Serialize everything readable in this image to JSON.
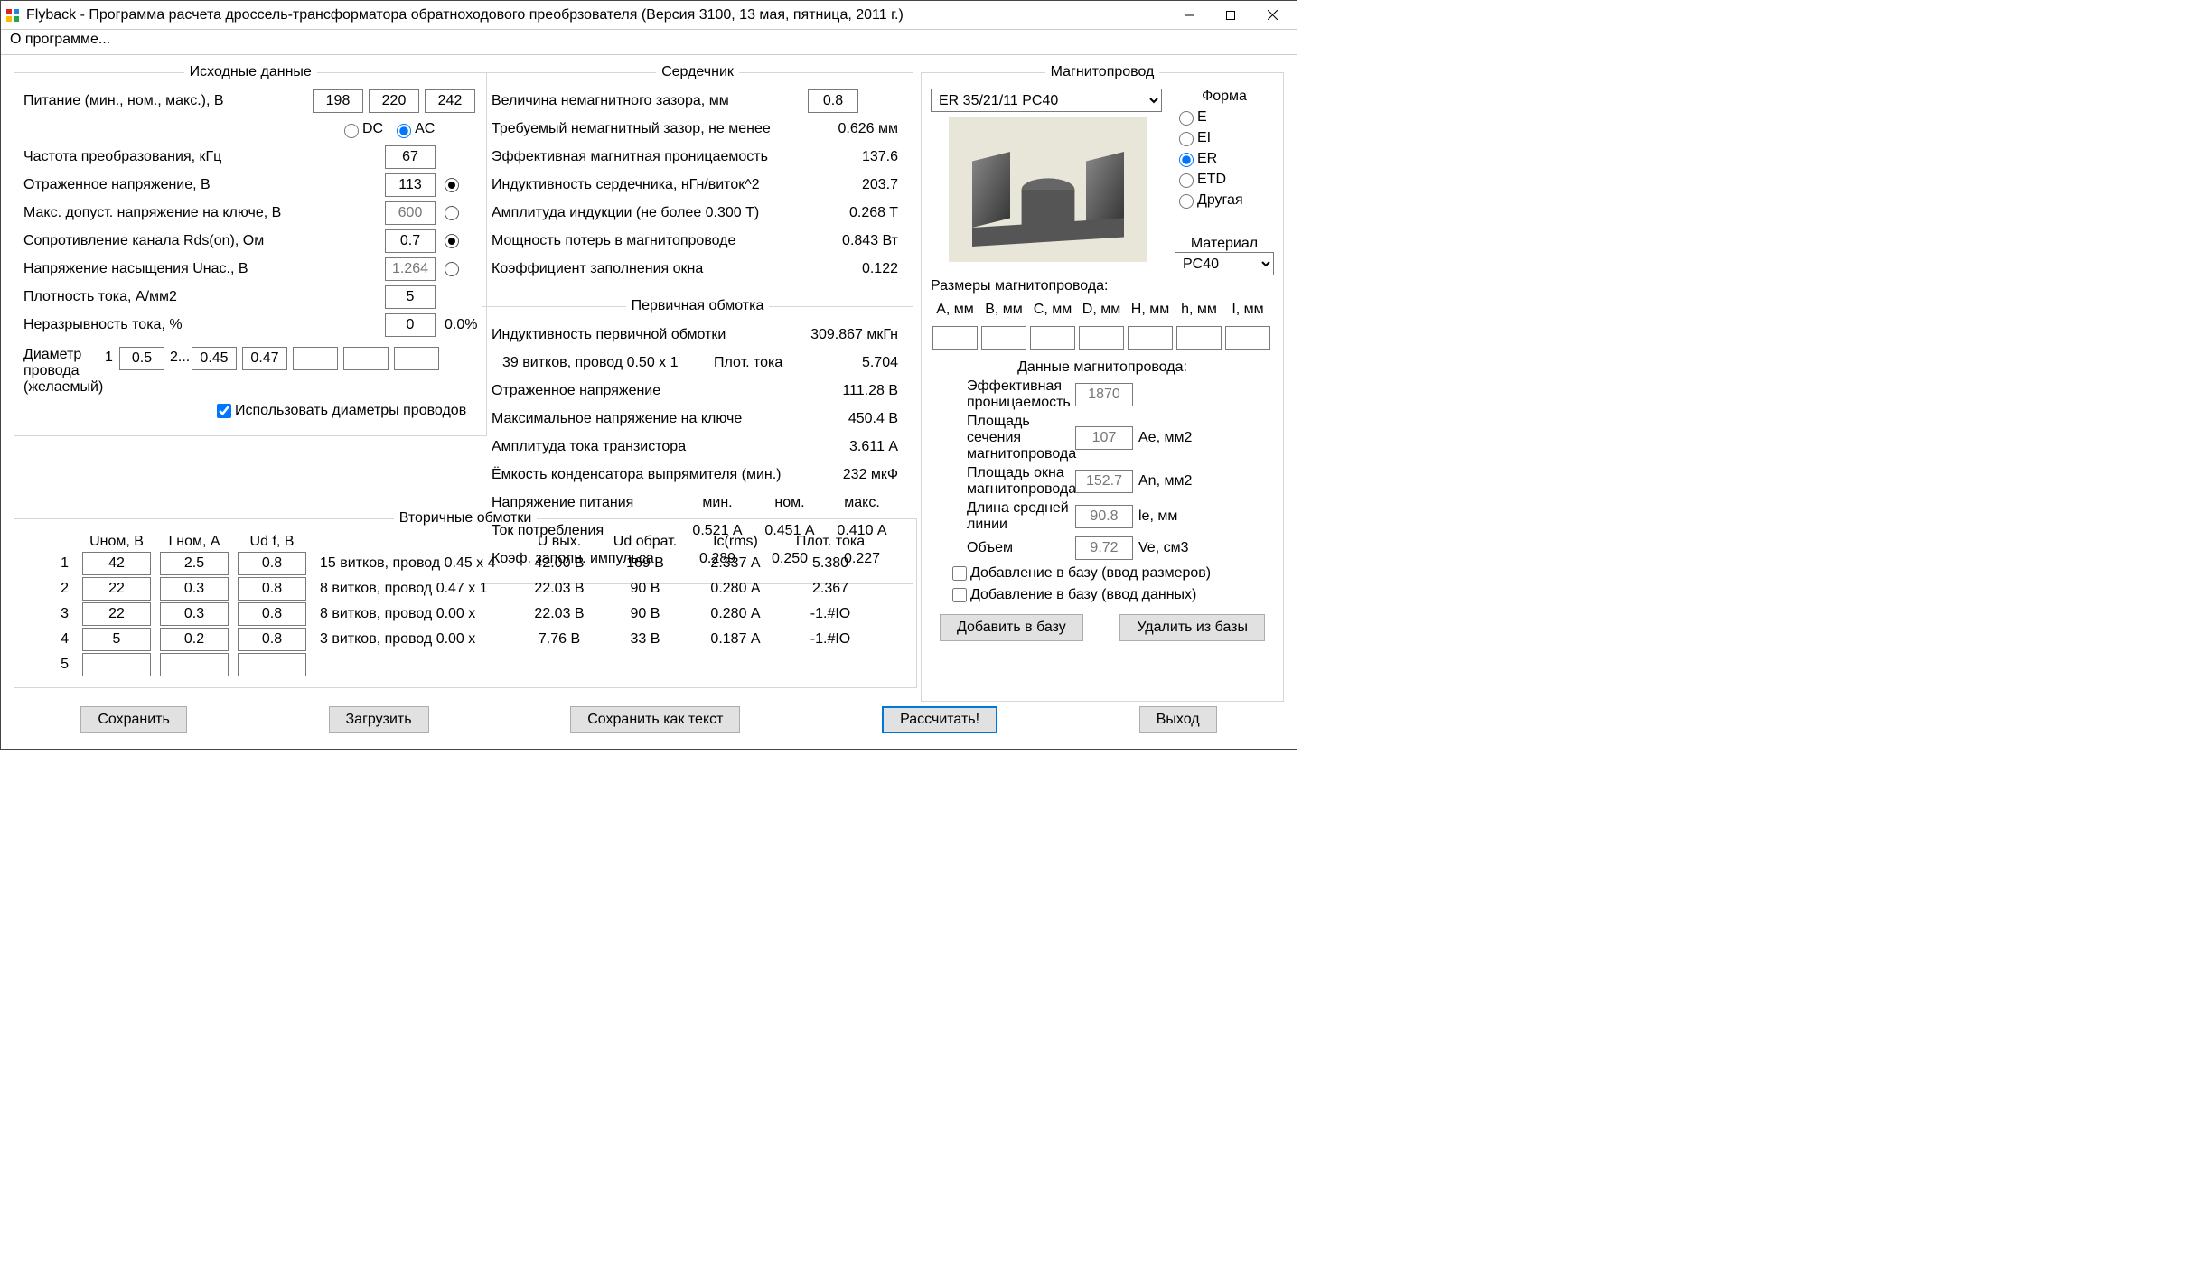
{
  "window": {
    "title": "Flyback - Программа расчета дроссель-трансформатора обратноходового преобрзователя (Версия 3100, 13 мая, пятница, 2011 г.)"
  },
  "menu": {
    "about": "О программе..."
  },
  "input_group": {
    "legend": "Исходные данные",
    "supply_lbl": "Питание (мин., ном., макс.), В",
    "supply_min": "198",
    "supply_nom": "220",
    "supply_max": "242",
    "dc": "DC",
    "ac": "AC",
    "freq_lbl": "Частота преобразования, кГц",
    "freq": "67",
    "vrefl_lbl": "Отраженное напряжение, В",
    "vrefl": "113",
    "vsw_lbl": "Макс. допуст. напряжение на ключе, В",
    "vsw": "600",
    "rds_lbl": "Сопротивление канала Rds(on), Ом",
    "rds": "0.7",
    "usat_lbl": "Напряжение насыщения Uнас., В",
    "usat": "1.264",
    "jdens_lbl": "Плотность тока, А/мм2",
    "jdens": "5",
    "cont_lbl": "Неразрывность тока, %",
    "cont": "0",
    "cont_out": "0.0%",
    "wire_lbl1": "Диаметр",
    "wire_lbl2": "провода",
    "wire_lbl3": "(желаемый)",
    "w1": "1",
    "w1v": "0.5",
    "w2": "2...",
    "w2v": "0.45",
    "w3v": "0.47",
    "use_dia": "Использовать диаметры проводов"
  },
  "core_group": {
    "legend": "Сердечник",
    "gap_lbl": "Величина немагнитного зазора, мм",
    "gap": "0.8",
    "metrics": [
      {
        "l": "Требуемый немагнитный зазор, не менее",
        "v": "0.626 мм"
      },
      {
        "l": "Эффективная магнитная проницаемость",
        "v": "137.6"
      },
      {
        "l": "Индуктивность сердечника, нГн/виток^2",
        "v": "203.7"
      },
      {
        "l": "Амплитуда индукции        (не более 0.300 Т)",
        "v": "0.268 T"
      },
      {
        "l": "Мощность потерь в магнитопроводе",
        "v": "0.843 Вт"
      },
      {
        "l": "Коэффициент заполнения окна",
        "v": "0.122"
      }
    ]
  },
  "primary_group": {
    "legend": "Первичная обмотка",
    "l1": "Индуктивность первичной обмотки",
    "v1": "309.867 мкГн",
    "l2a": "39 витков,  провод  0.50 x 1",
    "l2b": "Плот. тока",
    "v2": "5.704",
    "l3": "Отраженное напряжение",
    "v3": "111.28 В",
    "l4": "Максимальное напряжение на ключе",
    "v4": "450.4 В",
    "l5": "Амплитуда тока транзистора",
    "v5": "3.611 А",
    "l6": "Ёмкость конденсатора выпрямителя (мин.)",
    "v6": "232 мкФ",
    "l7": "Напряжение питания",
    "h_min": "мин.",
    "h_nom": "ном.",
    "h_max": "макс.",
    "l8": "Ток потребления",
    "v8a": "0.521 А",
    "v8b": "0.451 А",
    "v8c": "0.410 А",
    "l9": "Коэф. заполн. импульса",
    "v9a": "0.289",
    "v9b": "0.250",
    "v9c": "0.227"
  },
  "sec_group": {
    "legend": "Вторичные обмотки",
    "hdr": {
      "u": "Uном, В",
      "i": "I ном, А",
      "ud": "Ud f, В",
      "uvyh": "U вых.",
      "udobr": "Ud обрат.",
      "ic": "Ic(rms)",
      "j": "Плот. тока"
    },
    "rows": [
      {
        "n": "1",
        "u": "42",
        "i": "2.5",
        "ud": "0.8",
        "desc": "15 витков,  провод  0.45 x 4",
        "uvyh": "42.00 В",
        "udobr": "169 В",
        "ic": "2.337 А",
        "j": "5.380"
      },
      {
        "n": "2",
        "u": "22",
        "i": "0.3",
        "ud": "0.8",
        "desc": "8 витков,  провод  0.47 x 1",
        "uvyh": "22.03 В",
        "udobr": "90 В",
        "ic": "0.280 А",
        "j": "2.367"
      },
      {
        "n": "3",
        "u": "22",
        "i": "0.3",
        "ud": "0.8",
        "desc": "8 витков,  провод  0.00 x",
        "uvyh": "22.03 В",
        "udobr": "90 В",
        "ic": "0.280 А",
        "j": "-1.#IO"
      },
      {
        "n": "4",
        "u": "5",
        "i": "0.2",
        "ud": "0.8",
        "desc": "3 витков,  провод  0.00 x",
        "uvyh": "7.76 В",
        "udobr": "33 В",
        "ic": "0.187 А",
        "j": "-1.#IO"
      },
      {
        "n": "5",
        "u": "",
        "i": "",
        "ud": "",
        "desc": "",
        "uvyh": "",
        "udobr": "",
        "ic": "",
        "j": ""
      }
    ]
  },
  "mag_group": {
    "legend": "Магнитопровод",
    "core_sel": "ER 35/21/11 PC40",
    "shape_lbl": "Форма",
    "shapes": [
      "E",
      "EI",
      "ER",
      "ETD",
      "Другая"
    ],
    "material_lbl": "Материал",
    "material": "PC40",
    "dims_lbl": "Размеры магнитопровода:",
    "dim_hdrs": [
      "A, мм",
      "B, мм",
      "C, мм",
      "D, мм",
      "H, мм",
      "h, мм",
      "I, мм"
    ],
    "data_lbl": "Данные магнитопровода:",
    "d_eff_l": "Эффективная проницаемость",
    "d_eff": "1870",
    "d_ae_l": "Площадь сечения магнитопровода",
    "d_ae": "107",
    "d_ae_u": "Ae, мм2",
    "d_an_l": "Площадь окна магнитопровода",
    "d_an": "152.7",
    "d_an_u": "An, мм2",
    "d_le_l": "Длина средней линии",
    "d_le": "90.8",
    "d_le_u": "le, мм",
    "d_ve_l": "Объем",
    "d_ve": "9.72",
    "d_ve_u": "Ve, см3",
    "add_dims": "Добавление в базу (ввод размеров)",
    "add_data": "Добавление в базу (ввод данных)",
    "btn_add": "Добавить в базу",
    "btn_del": "Удалить из базы"
  },
  "buttons": {
    "save": "Сохранить",
    "load": "Загрузить",
    "save_txt": "Сохранить как текст",
    "calc": "Рассчитать!",
    "exit": "Выход"
  }
}
